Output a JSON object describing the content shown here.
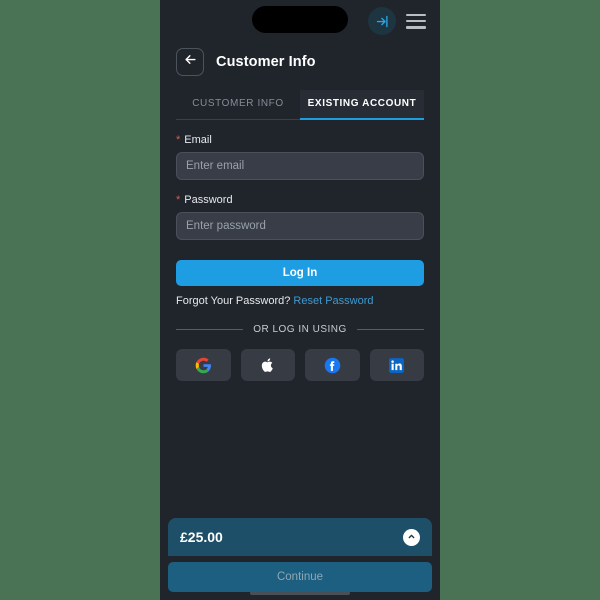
{
  "theme": {
    "page_background": "#4a7355",
    "panel_background": "#20252c",
    "accent_blue": "#1e9de3",
    "link_blue": "#3d9ad1",
    "teal_bar": "#1d5068",
    "continue_teal": "#1d5f80",
    "required_red": "#e05a4f",
    "input_fill": "#383d47"
  },
  "statusbar": {
    "login_icon": "sign-in-icon",
    "menu_icon": "hamburger-menu-icon"
  },
  "header": {
    "back_icon": "arrow-left-icon",
    "title": "Customer Info"
  },
  "tabs": [
    {
      "label": "CUSTOMER INFO",
      "active": false
    },
    {
      "label": "EXISTING ACCOUNT",
      "active": true
    }
  ],
  "form": {
    "required_marker": "*",
    "email": {
      "label": "Email",
      "placeholder": "Enter email",
      "value": ""
    },
    "password": {
      "label": "Password",
      "placeholder": "Enter password",
      "value": ""
    },
    "login_button": "Log In",
    "forgot_text": "Forgot Your Password?",
    "reset_link": "Reset Password"
  },
  "divider": {
    "text": "OR LOG IN USING"
  },
  "social": [
    {
      "name": "google-login-button",
      "icon": "google-icon"
    },
    {
      "name": "apple-login-button",
      "icon": "apple-icon"
    },
    {
      "name": "facebook-login-button",
      "icon": "facebook-icon"
    },
    {
      "name": "linkedin-login-button",
      "icon": "linkedin-icon"
    }
  ],
  "footer": {
    "price": "£25.00",
    "collapse_icon": "chevron-up-icon",
    "continue_button": "Continue"
  }
}
